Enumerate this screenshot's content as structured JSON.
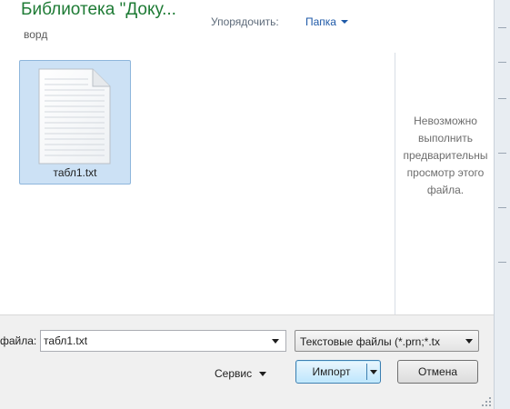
{
  "header": {
    "library_title": "Библиотека \"Доку...",
    "library_subtitle": "ворд",
    "sort_label": "Упорядочить:",
    "sort_value": "Папка"
  },
  "files": [
    {
      "name": "табл1.txt",
      "icon": "text-file-icon",
      "selected": true
    }
  ],
  "preview": {
    "message": "Невозможно выполнить предварительны просмотр этого файла."
  },
  "footer": {
    "filename_label": "файла:",
    "filename_value": "табл1.txt",
    "filetype_value": "Текстовые файлы (*.prn;*.tx",
    "service_label": "Сервис",
    "import_label": "Импорт",
    "cancel_label": "Отмена"
  },
  "colors": {
    "title_green": "#1e7b35",
    "link_blue": "#1f5aa8",
    "selection_bg": "#cce1f5"
  }
}
